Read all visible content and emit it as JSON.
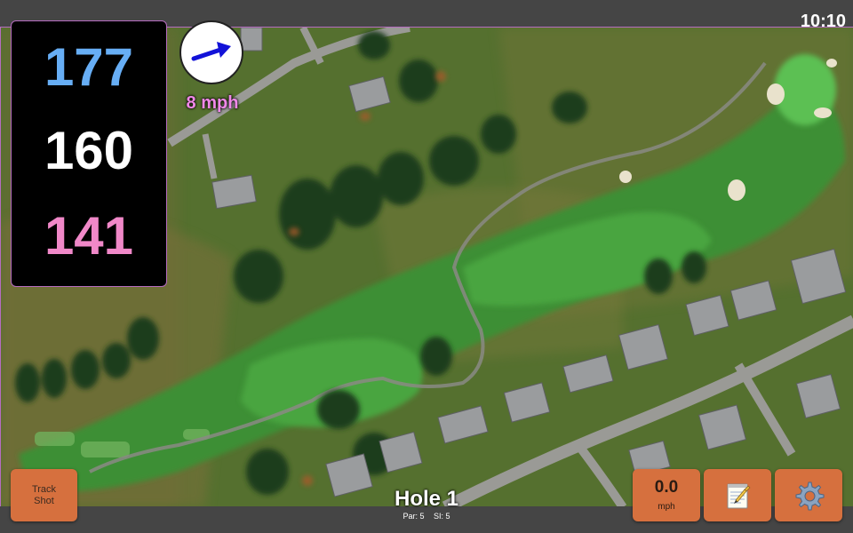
{
  "status_bar": {
    "time": "10:10"
  },
  "distances": {
    "back": "177",
    "middle": "160",
    "front": "141",
    "back_color": "#67aef5",
    "middle_color": "#ffffff",
    "front_color": "#f088c8"
  },
  "wind": {
    "speed": "8 mph",
    "arrow_icon": "arrow-right-icon",
    "arrow_color": "#1212d8"
  },
  "buttons": {
    "track_shot": "Track\nShot",
    "speed_value": "0.0",
    "speed_unit": "mph",
    "notes_icon": "notepad-icon",
    "settings_icon": "gear-icon"
  },
  "hole": {
    "title": "Hole 1",
    "par": "Par: 5",
    "si": "SI: 5"
  },
  "theme": {
    "button_color": "#d6703e",
    "bar_color": "#454545",
    "accent_border": "#b66cc0"
  }
}
